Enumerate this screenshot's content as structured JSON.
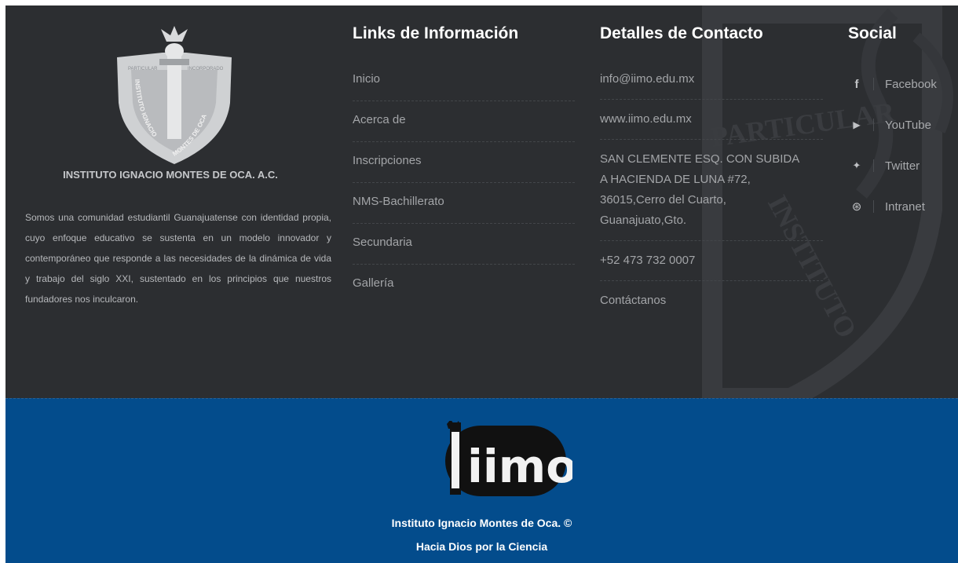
{
  "footer": {
    "institution_name": "INSTITUTO IGNACIO MONTES DE OCA. A.C.",
    "about_text": "Somos una comunidad estudiantil Guanajuatense con identidad propia, cuyo enfoque educativo se sustenta en un modelo innovador y contemporáneo que responde a las necesidades de la dinámica de vida y trabajo del siglo XXI, sustentado en los principios que nuestros fundadores nos inculcaron.",
    "crest_text": [
      "INSTITUTO IGNACIO",
      "MONTES DE OCA",
      "PARTICULAR",
      "INCORPORADO"
    ],
    "watermark_text": [
      "PARTICULAR",
      "INSTITUTO"
    ],
    "info_links": {
      "title": "Links de Información",
      "items": [
        "Inicio",
        "Acerca de",
        "Inscripciones",
        "NMS-Bachillerato",
        "Secundaria",
        "Gallería"
      ]
    },
    "contact": {
      "title": "Detalles de Contacto",
      "email": "info@iimo.edu.mx",
      "website": "www.iimo.edu.mx",
      "address": [
        "SAN CLEMENTE ESQ. CON SUBIDA",
        "A HACIENDA DE LUNA #72,",
        "36015,Cerro del Cuarto,",
        "Guanajuato,Gto."
      ],
      "phone": "+52 473 732 0007",
      "contact_link": "Contáctanos"
    },
    "social": {
      "title": "Social",
      "items": [
        {
          "icon": "facebook-icon",
          "glyph": "f",
          "label": "Facebook"
        },
        {
          "icon": "youtube-icon",
          "glyph": "▶",
          "label": "YouTube"
        },
        {
          "icon": "twitter-icon",
          "glyph": "✦",
          "label": "Twitter"
        },
        {
          "icon": "dribbble-icon",
          "glyph": "⊛",
          "label": "Intranet"
        }
      ]
    }
  },
  "bottom_bar": {
    "logo_text": "iimo",
    "copyright": "Instituto Ignacio Montes de Oca. ©",
    "motto": "Hacia Dios por la Ciencia"
  },
  "colors": {
    "dark_bg": "#2c2e31",
    "blue_bg": "#034c8c",
    "link_text": "#a3a5a8",
    "heading_text": "#ffffff"
  }
}
